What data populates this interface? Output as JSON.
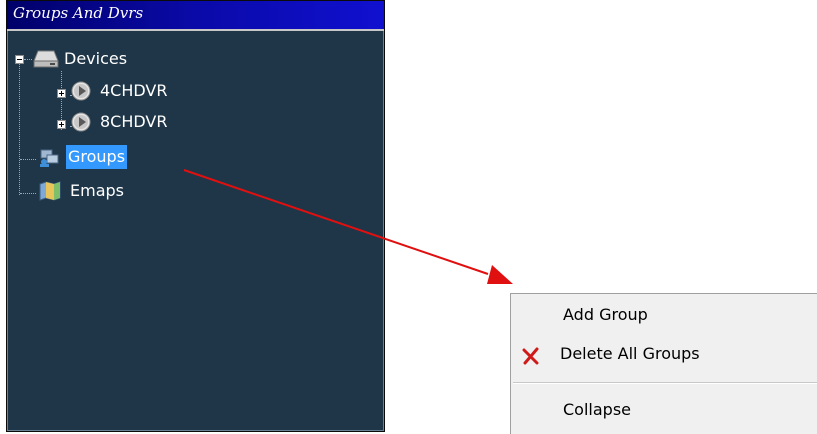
{
  "panel": {
    "title": "Groups And Dvrs",
    "tree": {
      "devices": {
        "label": "Devices",
        "expanded": true
      },
      "dvrs": [
        {
          "label": "4CHDVR",
          "expanded": false
        },
        {
          "label": "8CHDVR",
          "expanded": false
        }
      ],
      "groups": {
        "label": "Groups",
        "selected": true
      },
      "emaps": {
        "label": "Emaps"
      }
    }
  },
  "context_menu": {
    "items": [
      {
        "label": "Add Group",
        "icon": ""
      },
      {
        "label": "Delete All Groups",
        "icon": "red-x-icon"
      },
      {
        "label": "Collapse",
        "icon": ""
      }
    ]
  },
  "colors": {
    "panel_background": "#1e3648",
    "title_gradient_start": "#00006a",
    "title_gradient_end": "#1010d0",
    "selection": "#3399ff",
    "arrow": "#e01010",
    "menu_background": "#f0f0f0"
  }
}
